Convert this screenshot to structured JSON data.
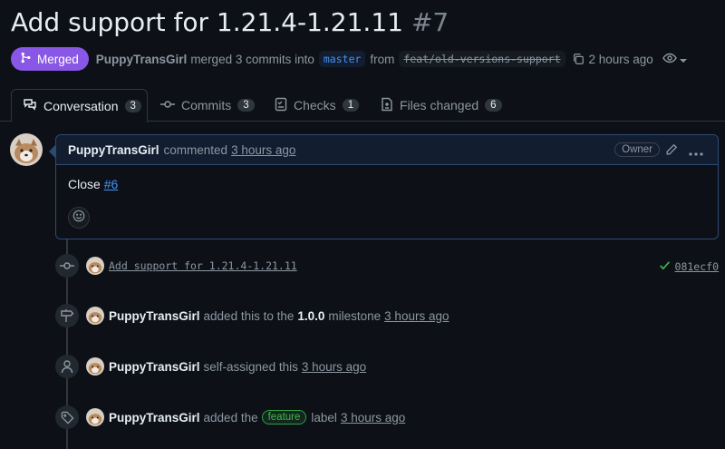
{
  "header": {
    "title": "Add support for 1.21.4-1.21.11",
    "number": "#7",
    "state": "Merged",
    "author": "PuppyTransGirl",
    "merge_text": "merged 3 commits into",
    "base_branch": "master",
    "from_text": "from",
    "head_branch": "feat/old-versions-support",
    "time": "2 hours ago"
  },
  "tabs": [
    {
      "label": "Conversation",
      "count": "3"
    },
    {
      "label": "Commits",
      "count": "3"
    },
    {
      "label": "Checks",
      "count": "1"
    },
    {
      "label": "Files changed",
      "count": "6"
    }
  ],
  "comment": {
    "author": "PuppyTransGirl",
    "action": "commented",
    "time": "3 hours ago",
    "role": "Owner",
    "body_prefix": "Close",
    "body_link": "#6"
  },
  "timeline": {
    "commit": {
      "message": "Add support for 1.21.4-1.21.11",
      "sha": "081ecf0"
    },
    "milestone": {
      "author": "PuppyTransGirl",
      "text_before": "added this to the",
      "milestone": "1.0.0",
      "text_after": "milestone",
      "time": "3 hours ago"
    },
    "assign": {
      "author": "PuppyTransGirl",
      "text": "self-assigned this",
      "time": "3 hours ago"
    },
    "label": {
      "author": "PuppyTransGirl",
      "text_before": "added the",
      "label": "feature",
      "text_after": "label",
      "time": "3 hours ago"
    }
  },
  "colors": {
    "merged": "#8957e5",
    "link": "#4493f8",
    "success": "#3fb950",
    "background": "#0d1117"
  },
  "icons": [
    "merge-icon",
    "copy-icon",
    "eye-icon",
    "comment-icon",
    "commit-icon",
    "checklist-icon",
    "file-diff-icon",
    "pencil-icon",
    "kebab-icon",
    "smiley-icon",
    "milestone-icon",
    "person-icon",
    "tag-icon",
    "check-icon"
  ]
}
